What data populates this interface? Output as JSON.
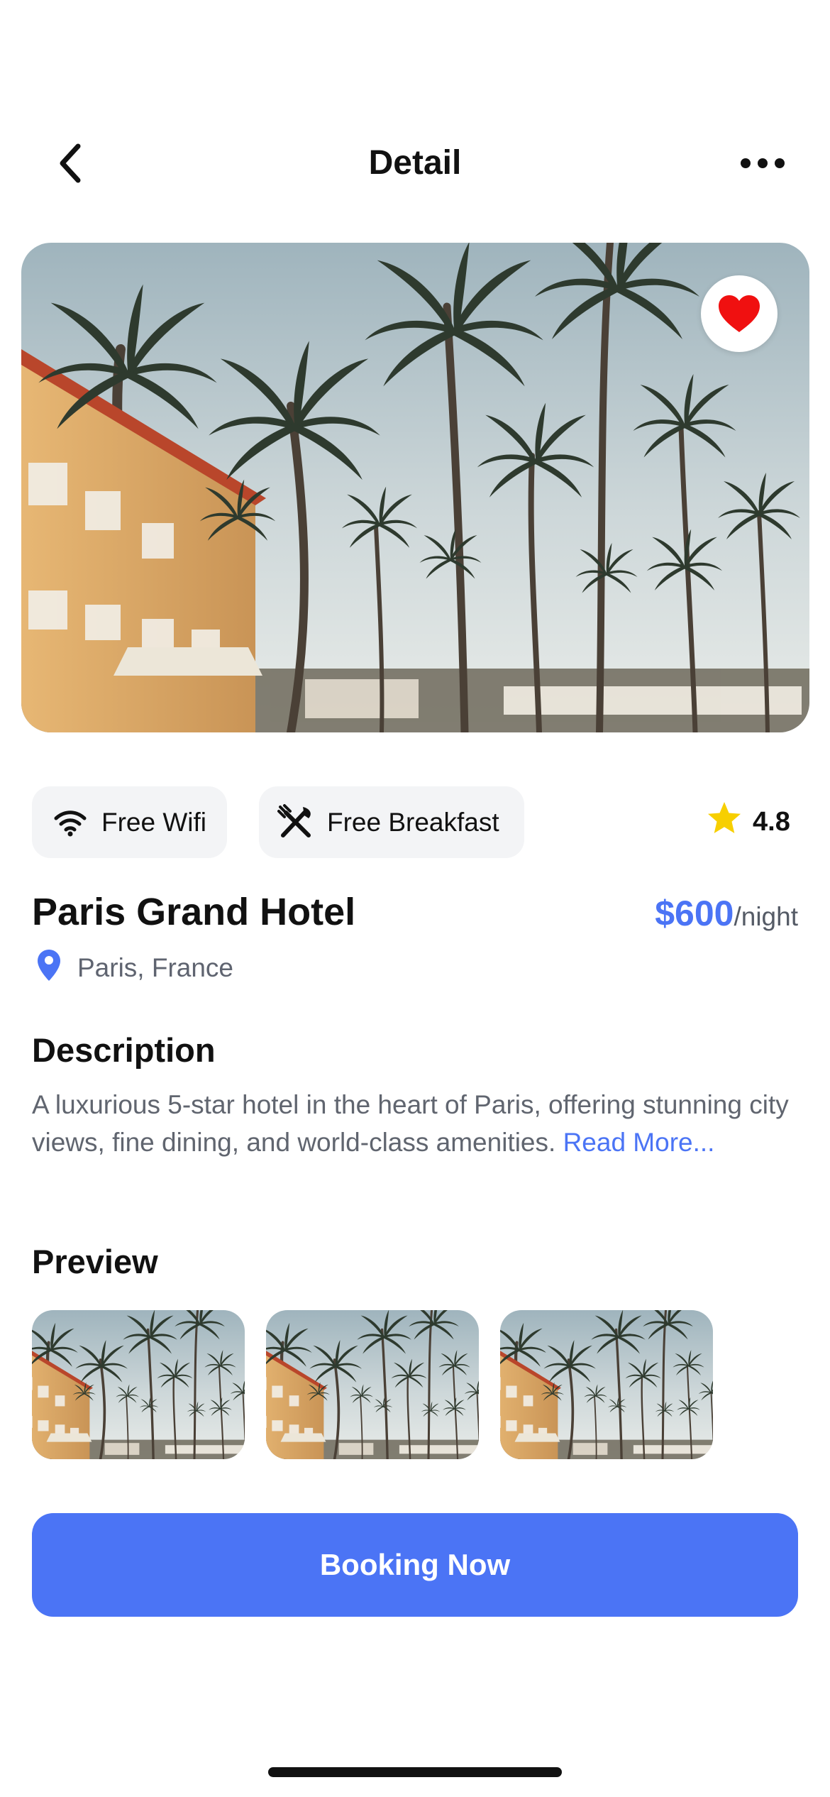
{
  "header": {
    "title": "Detail",
    "back_icon": "chevron-left-icon",
    "more_icon": "ellipsis-icon"
  },
  "hero": {
    "favorite_icon": "heart-icon",
    "favorite_color": "#f01010"
  },
  "amenities": [
    {
      "icon": "wifi-icon",
      "label": "Free Wifi"
    },
    {
      "icon": "fork-knife-icon",
      "label": "Free Breakfast"
    }
  ],
  "rating": {
    "icon": "star-icon",
    "value": "4.8",
    "color": "#f7cf00"
  },
  "hotel": {
    "name": "Paris Grand Hotel",
    "price": "$600",
    "price_unit": "/night",
    "location": "Paris, France",
    "location_icon": "location-pin-icon"
  },
  "description": {
    "title": "Description",
    "text": "A luxurious 5-star hotel in the heart of Paris, offering stunning city views, fine dining, and world-class amenities.",
    "read_more": "Read More..."
  },
  "preview": {
    "title": "Preview",
    "count": 3
  },
  "cta": {
    "label": "Booking Now"
  },
  "colors": {
    "accent": "#4b74f5",
    "chip_bg": "#f3f4f6",
    "muted_text": "#60656f"
  }
}
